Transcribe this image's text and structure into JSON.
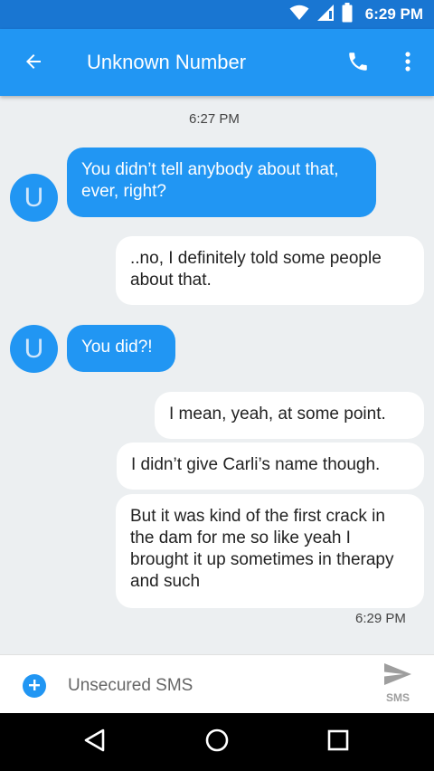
{
  "status_bar": {
    "time": "6:29 PM",
    "icons": [
      "wifi-icon",
      "signal-icon",
      "battery-icon"
    ]
  },
  "app_bar": {
    "title": "Unknown Number",
    "icons": [
      "back-arrow-icon",
      "phone-icon",
      "more-vert-icon"
    ]
  },
  "conversation": {
    "timestamps": [
      "6:27 PM",
      "6:29 PM"
    ],
    "avatar_letter": "U",
    "messages": [
      {
        "from": "them",
        "text": "You didn’t tell anybody about that, ever, right?"
      },
      {
        "from": "me",
        "text": "..no, I definitely told some people about that."
      },
      {
        "from": "them",
        "text": "You did?!"
      },
      {
        "from": "me",
        "text": "I mean, yeah, at some point."
      },
      {
        "from": "me",
        "text": "I didn’t give Carli’s name though."
      },
      {
        "from": "me",
        "text": "But it was kind of the first crack in the dam for me so like yeah I brought it up sometimes in therapy and such"
      }
    ]
  },
  "compose": {
    "placeholder": "Unsecured SMS",
    "send_label": "SMS"
  },
  "colors": {
    "primary": "#2196f3",
    "primary_dark": "#1976d2",
    "background": "#eceff1",
    "outgoing_bubble": "#ffffff"
  }
}
